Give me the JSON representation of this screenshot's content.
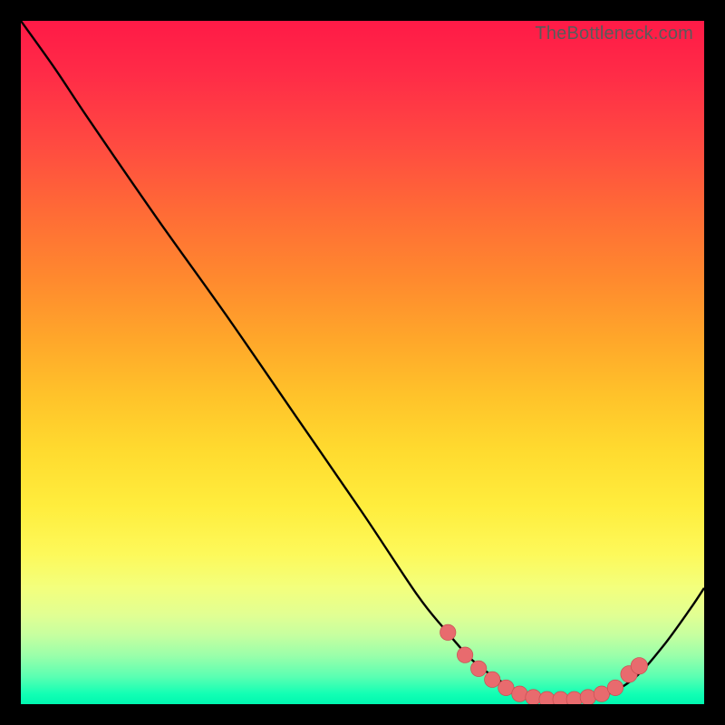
{
  "watermark": "TheBottleneck.com",
  "colors": {
    "background": "#000000",
    "line": "#000000",
    "dot_fill": "#e86b6e",
    "dot_stroke": "#c94f52"
  },
  "chart_data": {
    "type": "line",
    "title": "",
    "xlabel": "",
    "ylabel": "",
    "xlim": [
      0,
      100
    ],
    "ylim": [
      0,
      100
    ],
    "grid": false,
    "legend": false,
    "series": [
      {
        "name": "curve",
        "points": [
          {
            "x": 0,
            "y": 100
          },
          {
            "x": 5,
            "y": 93
          },
          {
            "x": 10,
            "y": 85.5
          },
          {
            "x": 20,
            "y": 71
          },
          {
            "x": 30,
            "y": 57
          },
          {
            "x": 40,
            "y": 42.5
          },
          {
            "x": 50,
            "y": 28
          },
          {
            "x": 58,
            "y": 16
          },
          {
            "x": 62,
            "y": 11
          },
          {
            "x": 66,
            "y": 6.5
          },
          {
            "x": 70,
            "y": 3.5
          },
          {
            "x": 74,
            "y": 1.5
          },
          {
            "x": 78,
            "y": 0.7
          },
          {
            "x": 82,
            "y": 0.7
          },
          {
            "x": 86,
            "y": 1.5
          },
          {
            "x": 90,
            "y": 4
          },
          {
            "x": 94,
            "y": 8.5
          },
          {
            "x": 98,
            "y": 14
          },
          {
            "x": 100,
            "y": 17
          }
        ]
      }
    ],
    "markers": [
      {
        "x": 62.5,
        "y": 10.5,
        "r": 1.0
      },
      {
        "x": 65,
        "y": 7.2,
        "r": 1.0
      },
      {
        "x": 67,
        "y": 5.2,
        "r": 1.0
      },
      {
        "x": 69,
        "y": 3.6,
        "r": 1.0
      },
      {
        "x": 71,
        "y": 2.4,
        "r": 1.0
      },
      {
        "x": 73,
        "y": 1.5,
        "r": 1.0
      },
      {
        "x": 75,
        "y": 1.0,
        "r": 1.0
      },
      {
        "x": 77,
        "y": 0.7,
        "r": 1.0
      },
      {
        "x": 79,
        "y": 0.7,
        "r": 1.0
      },
      {
        "x": 81,
        "y": 0.7,
        "r": 1.0
      },
      {
        "x": 83,
        "y": 1.0,
        "r": 1.0
      },
      {
        "x": 85,
        "y": 1.5,
        "r": 1.0
      },
      {
        "x": 87,
        "y": 2.4,
        "r": 1.0
      },
      {
        "x": 89,
        "y": 4.4,
        "r": 1.1
      },
      {
        "x": 90.5,
        "y": 5.6,
        "r": 1.1
      }
    ]
  }
}
